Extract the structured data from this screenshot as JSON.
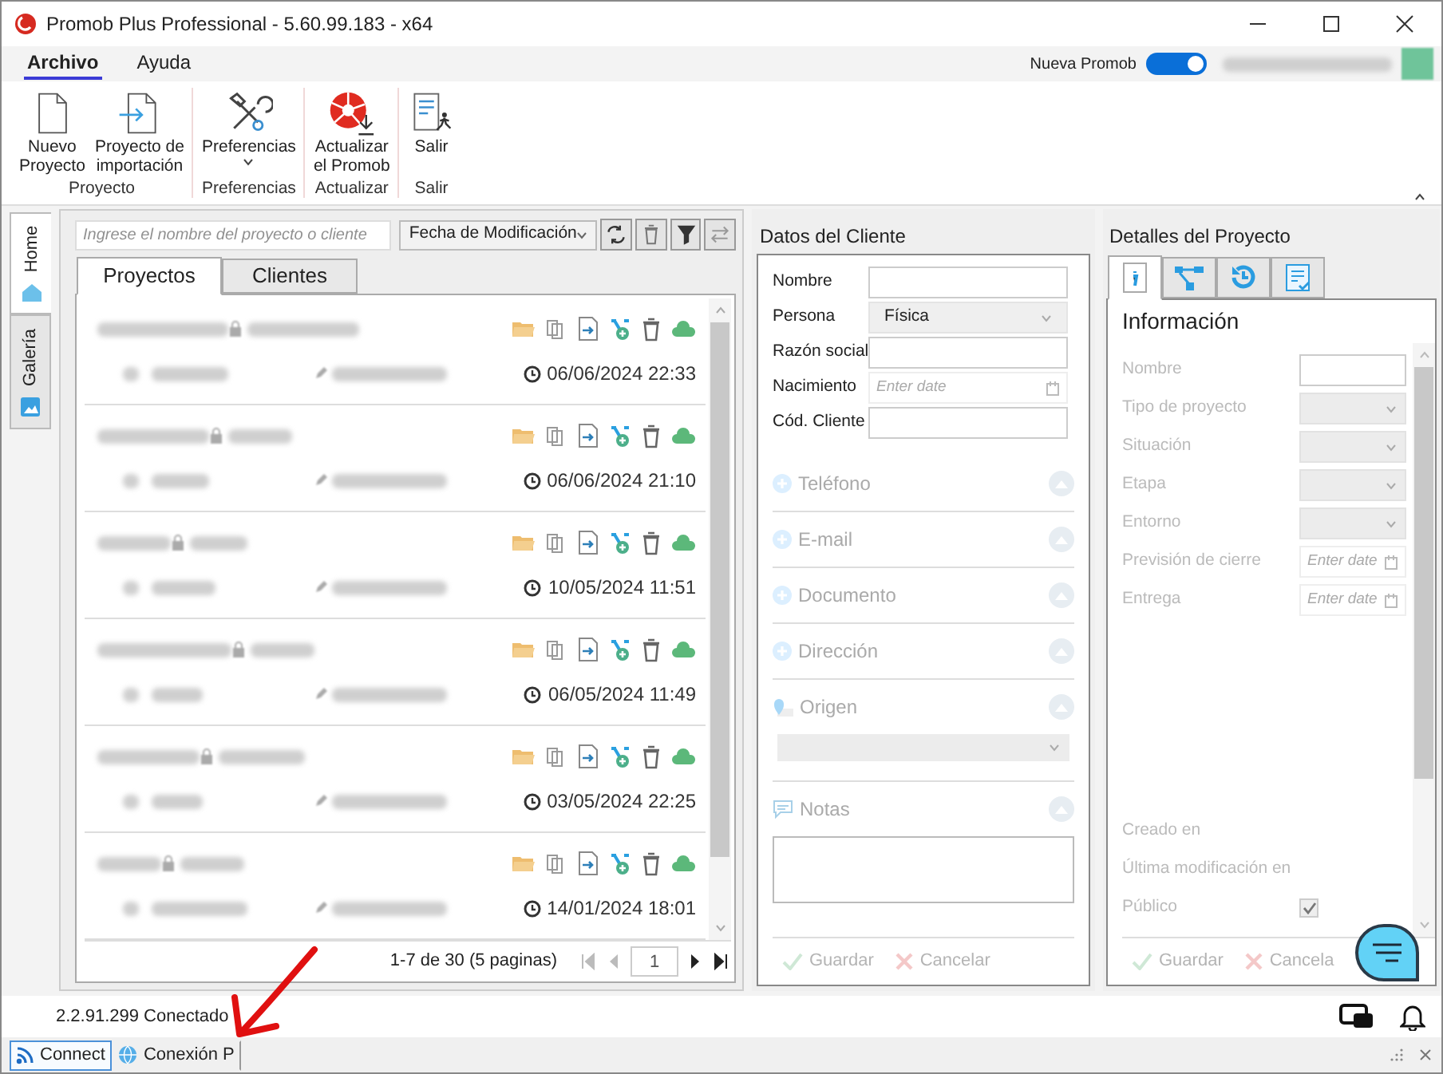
{
  "window": {
    "title": "Promob Plus Professional - 5.60.99.183 - x64"
  },
  "menu_tabs": [
    {
      "label": "Archivo",
      "selected": true
    },
    {
      "label": "Ayuda",
      "selected": false
    }
  ],
  "toggle": {
    "label": "Nueva Promob",
    "on": true
  },
  "ribbon": {
    "groups": [
      {
        "label": "Proyecto",
        "buttons": [
          {
            "lines": [
              "Nuevo",
              "Proyecto"
            ],
            "dropdown": false
          },
          {
            "lines": [
              "Proyecto de",
              "importación"
            ],
            "dropdown": false
          }
        ]
      },
      {
        "label": "Preferencias",
        "buttons": [
          {
            "lines": [
              "Preferencias"
            ],
            "dropdown": true
          }
        ]
      },
      {
        "label": "Actualizar",
        "buttons": [
          {
            "lines": [
              "Actualizar",
              "el Promob"
            ],
            "dropdown": false
          }
        ]
      },
      {
        "label": "Salir",
        "buttons": [
          {
            "lines": [
              "Salir"
            ],
            "dropdown": false
          }
        ]
      }
    ]
  },
  "side_tabs": [
    {
      "label": "Home",
      "selected": true
    },
    {
      "label": "Galería",
      "selected": false
    }
  ],
  "search": {
    "placeholder": "Ingrese el nombre del proyecto o cliente"
  },
  "sort": {
    "value": "Fecha de Modificación"
  },
  "list_tabs": [
    {
      "label": "Proyectos",
      "selected": true
    },
    {
      "label": "Clientes",
      "selected": false
    }
  ],
  "projects": [
    {
      "date": "06/06/2024 22:33"
    },
    {
      "date": "06/06/2024 21:10"
    },
    {
      "date": "10/05/2024 11:51"
    },
    {
      "date": "06/05/2024 11:49"
    },
    {
      "date": "03/05/2024 22:25"
    },
    {
      "date": "14/01/2024 18:01"
    }
  ],
  "pager": {
    "summary": "1-7 de 30 (5 paginas)",
    "page": "1"
  },
  "client": {
    "title": "Datos del Cliente",
    "fields": [
      {
        "label": "Nombre",
        "kind": "text"
      },
      {
        "label": "Persona",
        "kind": "select",
        "value": "Física"
      },
      {
        "label": "Razón social",
        "kind": "text"
      },
      {
        "label": "Nacimiento",
        "kind": "date",
        "placeholder": "Enter date"
      },
      {
        "label": "Cód. Cliente",
        "kind": "text"
      }
    ],
    "sections": [
      {
        "label": "Teléfono",
        "kind": "add"
      },
      {
        "label": "E-mail",
        "kind": "add"
      },
      {
        "label": "Documento",
        "kind": "add"
      },
      {
        "label": "Dirección",
        "kind": "add"
      },
      {
        "label": "Origen",
        "kind": "origin"
      },
      {
        "label": "Notas",
        "kind": "notes"
      }
    ],
    "buttons": [
      {
        "label": "Guardar",
        "kind": "save",
        "disabled": true
      },
      {
        "label": "Cancelar",
        "kind": "cancel",
        "disabled": true
      }
    ]
  },
  "project": {
    "title": "Detalles del Proyecto",
    "tabs": [
      {
        "selected": true
      },
      {
        "selected": false
      },
      {
        "selected": false
      },
      {
        "selected": false
      }
    ],
    "heading": "Información",
    "fields": [
      {
        "label": "Nombre",
        "kind": "text"
      },
      {
        "label": "Tipo de proyecto",
        "kind": "select"
      },
      {
        "label": "Situación",
        "kind": "select"
      },
      {
        "label": "Etapa",
        "kind": "select"
      },
      {
        "label": "Entorno",
        "kind": "select"
      },
      {
        "label": "Previsión de cierre",
        "kind": "date",
        "placeholder": "Enter date"
      },
      {
        "label": "Entrega",
        "kind": "date",
        "placeholder": "Enter date"
      }
    ],
    "info": [
      {
        "label": "Creado en",
        "kind": "text"
      },
      {
        "label": "Última modificación en",
        "kind": "text"
      },
      {
        "label": "Público",
        "kind": "check",
        "checked": true
      }
    ],
    "buttons": [
      {
        "label": "Guardar",
        "kind": "save",
        "disabled": true
      },
      {
        "label": "Cancela",
        "kind": "cancel",
        "disabled": true
      }
    ]
  },
  "status": {
    "text": "2.2.91.299 Conectado"
  },
  "taskbar": [
    {
      "label": "Connect",
      "selected": true
    },
    {
      "label": "Conexión P",
      "selected": false
    }
  ]
}
